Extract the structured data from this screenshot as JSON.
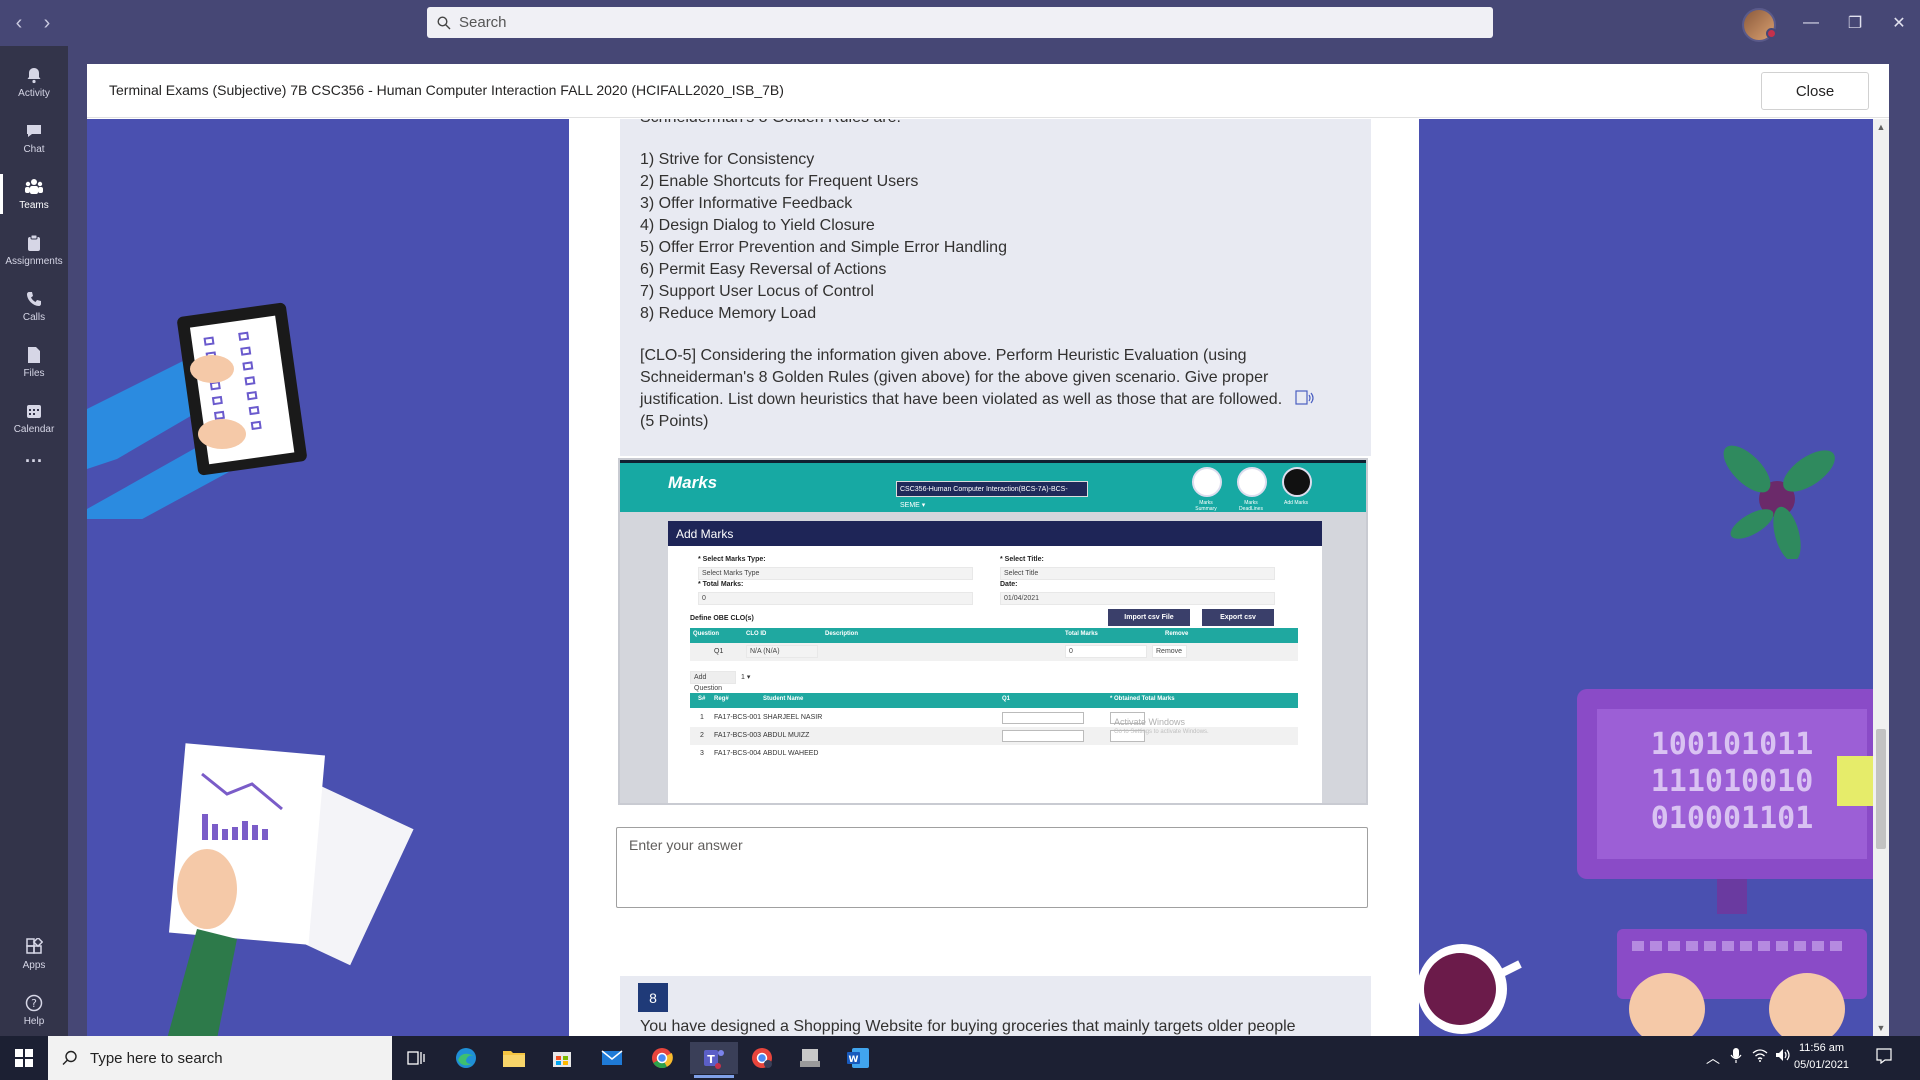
{
  "search": {
    "placeholder": "Search"
  },
  "rail": {
    "items": [
      {
        "label": "Activity"
      },
      {
        "label": "Chat"
      },
      {
        "label": "Teams"
      },
      {
        "label": "Assignments"
      },
      {
        "label": "Calls"
      },
      {
        "label": "Files"
      },
      {
        "label": "Calendar"
      },
      {
        "label": "..."
      }
    ],
    "bottom": [
      {
        "label": "Apps"
      },
      {
        "label": "Help"
      }
    ]
  },
  "modal": {
    "title": "Terminal Exams (Subjective) 7B CSC356 - Human Computer Interaction FALL 2020 (HCIFALL2020_ISB_7B)",
    "close_label": "Close"
  },
  "question": {
    "heading_partial": "Schneiderman's 8 Golden Rules are:",
    "rules": [
      "1) Strive for Consistency",
      "2) Enable Shortcuts for Frequent Users",
      "3) Offer Informative Feedback",
      "4) Design Dialog to Yield Closure",
      "5) Offer Error Prevention and Simple Error Handling",
      "6) Permit Easy Reversal of Actions",
      "7) Support User Locus of Control",
      "8) Reduce Memory Load"
    ],
    "prompt": "[CLO-5] Considering the information given above. Perform Heuristic Evaluation (using Schneiderman's 8 Golden Rules (given above) for the above given scenario. Give proper justification. List down heuristics that have been violated as well as those that are followed.",
    "points": "(5 Points)"
  },
  "embed": {
    "brand": "Marks",
    "course_select": "CSC356-Human Computer Interaction(BCS-7A)-BCS-SEME ▾",
    "top_icons": [
      {
        "label": "Marks Summary"
      },
      {
        "label": "Marks DeadLines"
      },
      {
        "label": "Add Marks"
      }
    ],
    "panel_title": "Add Marks",
    "select_marks_type_label": "* Select Marks Type:",
    "select_marks_type_value": "Select Marks Type",
    "select_title_label": "* Select Title:",
    "select_title_value": "Select Title",
    "total_marks_label": "* Total Marks:",
    "total_marks_value": "0",
    "date_label": "Date:",
    "date_value": "01/04/2021",
    "define_obe": "Define OBE CLO(s)",
    "import_btn": "Import csv File",
    "export_btn": "Export csv",
    "clo_headers": [
      "Question",
      "CLO ID",
      "Description",
      "Total Marks",
      "Remove"
    ],
    "clo_row": {
      "question": "Q1",
      "clo": "N/A (N/A)",
      "total": "0",
      "remove": "Remove"
    },
    "add_question": "Add Question",
    "add_question_count": "1 ▾",
    "student_headers": [
      "S#",
      "Reg#",
      "Student Name",
      "Q1",
      "* Obtained Total Marks"
    ],
    "students": [
      {
        "sn": "1",
        "reg": "FA17-BCS-001",
        "name": "SHARJEEL NASIR"
      },
      {
        "sn": "2",
        "reg": "FA17-BCS-003",
        "name": "ABDUL MUIZZ"
      },
      {
        "sn": "3",
        "reg": "FA17-BCS-004",
        "name": "ABDUL WAHEED"
      }
    ],
    "watermark_1": "Activate Windows",
    "watermark_2": "Go to Settings to activate Windows."
  },
  "answer": {
    "placeholder": "Enter your answer"
  },
  "question8": {
    "number": "8",
    "text": "You have designed a Shopping Website for buying groceries that mainly targets older people"
  },
  "taskbar": {
    "search_placeholder": "Type here to search",
    "time": "11:56 am",
    "date": "05/01/2021"
  },
  "colors": {
    "titlebar": "#464775",
    "rail": "#33344a",
    "canvas": "#4a50b0",
    "embed_teal": "#17a9a3",
    "embed_navy": "#1e2557"
  }
}
